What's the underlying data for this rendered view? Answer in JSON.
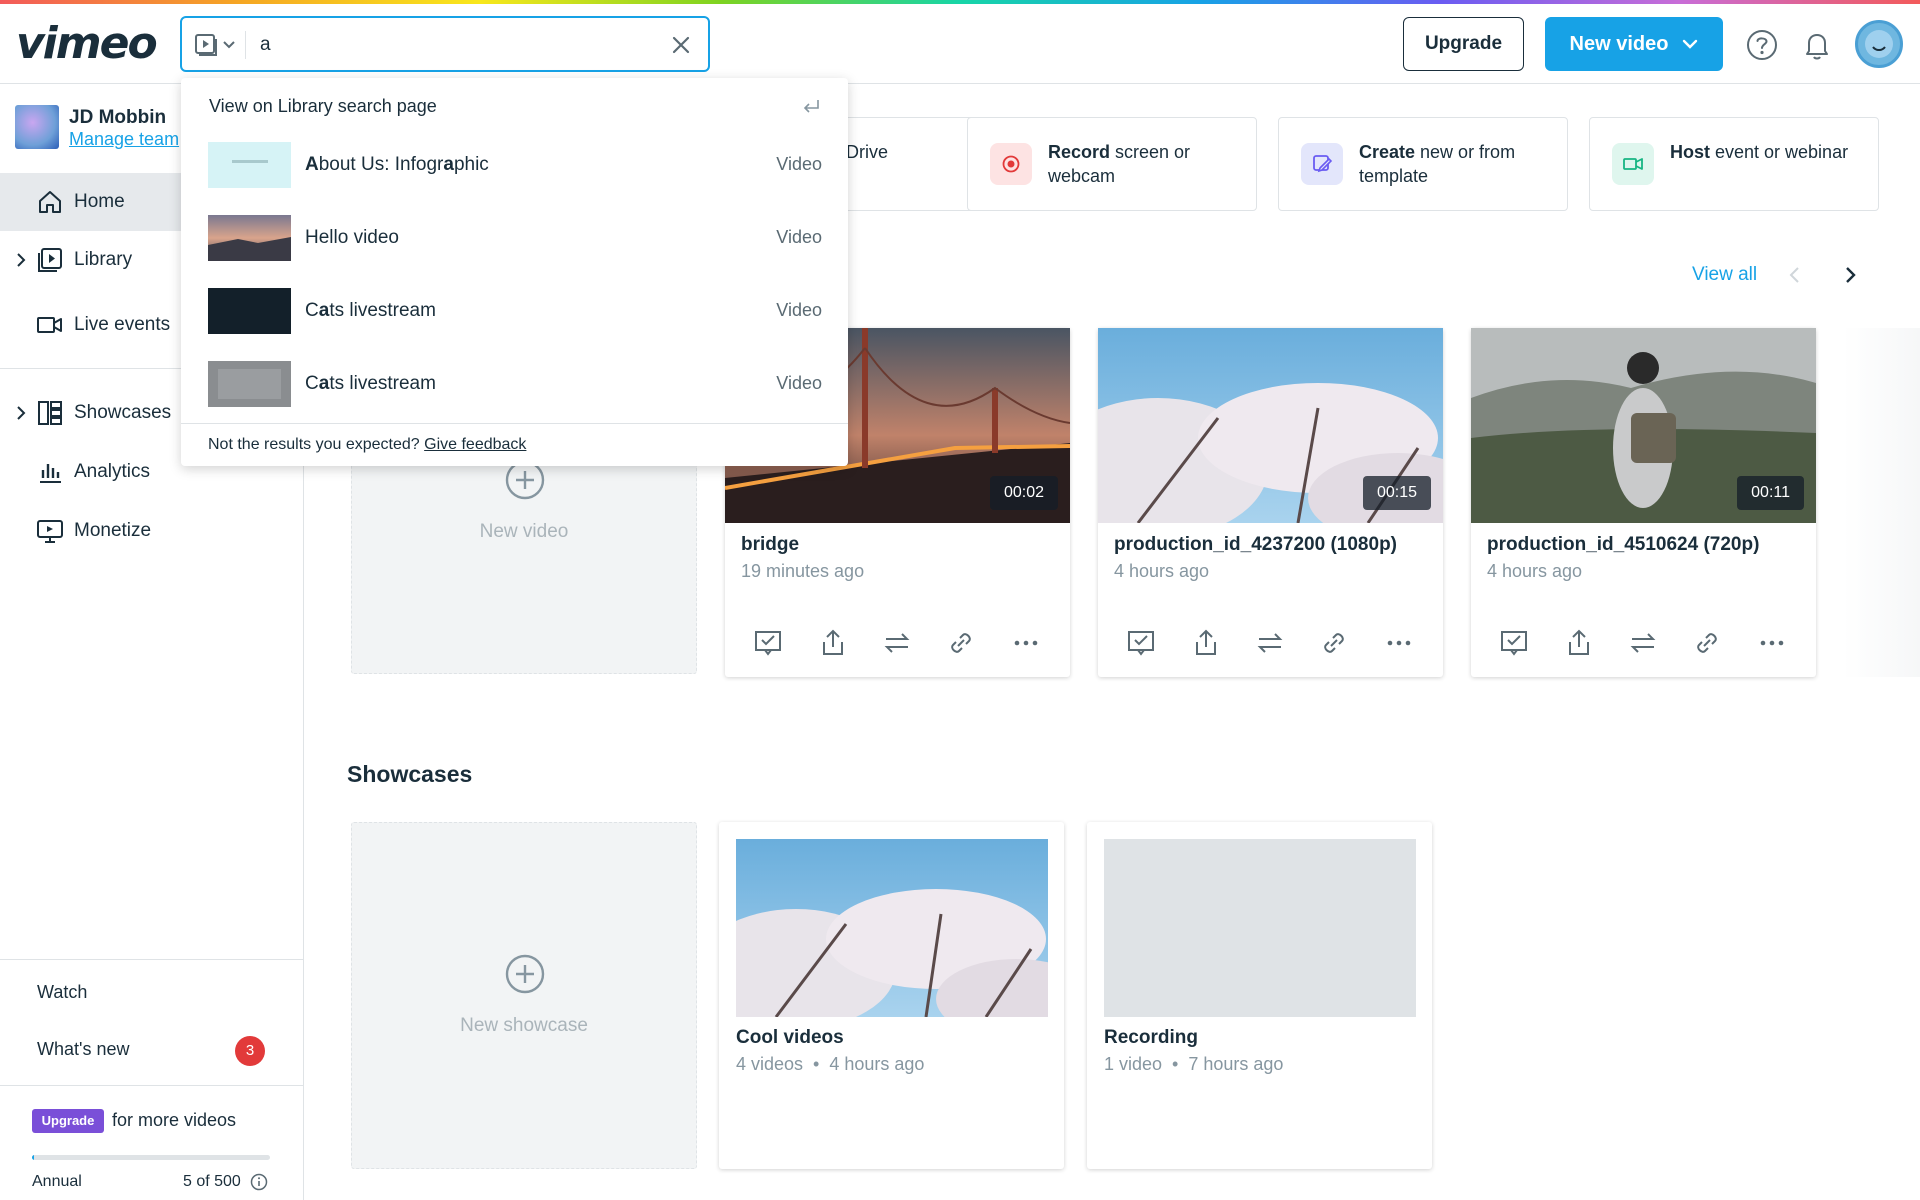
{
  "brand": {
    "logo": "vimeo"
  },
  "search": {
    "value": "a",
    "scope_icon": "video-library-icon"
  },
  "header": {
    "upgrade_label": "Upgrade",
    "new_video_label": "New video"
  },
  "team": {
    "name": "JD Mobbin",
    "manage_link": "Manage team"
  },
  "sidebar": {
    "items": [
      {
        "label": "Home",
        "icon": "home-icon"
      },
      {
        "label": "Library",
        "icon": "library-icon"
      },
      {
        "label": "Live events",
        "icon": "camera-icon"
      },
      {
        "label": "Showcases",
        "icon": "showcase-icon"
      },
      {
        "label": "Analytics",
        "icon": "analytics-icon"
      },
      {
        "label": "Monetize",
        "icon": "monetize-icon"
      }
    ],
    "watch": "Watch",
    "whats_new": "What's new",
    "whats_new_count": "3",
    "upgrade_badge": "Upgrade",
    "upgrade_text": "for more videos",
    "plan": "Annual",
    "usage": "5 of 500",
    "usage_fraction": 0.01
  },
  "actions": [
    {
      "bold": "",
      "text": "Drive"
    },
    {
      "bold": "Record",
      "text": " screen or webcam",
      "color": "#fde3e3",
      "accent": "#e23a3a"
    },
    {
      "bold": "Create",
      "text": " new or from template",
      "color": "#e3e6fb",
      "accent": "#6a5cf2"
    },
    {
      "bold": "Host",
      "text": " event or webinar",
      "color": "#dff6ee",
      "accent": "#17b583"
    }
  ],
  "recent": {
    "view_all": "View all",
    "new_video": "New video",
    "videos": [
      {
        "title": "bridge",
        "time": "19 minutes ago",
        "duration": "00:02"
      },
      {
        "title": "production_id_4237200 (1080p)",
        "time": "4 hours ago",
        "duration": "00:15"
      },
      {
        "title": "production_id_4510624 (720p)",
        "time": "4 hours ago",
        "duration": "00:11"
      }
    ]
  },
  "showcases": {
    "title": "Showcases",
    "new_showcase": "New showcase",
    "items": [
      {
        "title": "Cool videos",
        "videos": "4 videos",
        "time": "4 hours ago"
      },
      {
        "title": "Recording",
        "videos": "1 video",
        "time": "7 hours ago"
      }
    ]
  },
  "dropdown": {
    "header": "View on Library search page",
    "results": [
      {
        "prefix": "",
        "bold": "A",
        "rest": "bout Us: Infogr",
        "bold2": "a",
        "rest2": "phic",
        "type": "Video"
      },
      {
        "prefix": "Hello video",
        "bold": "",
        "rest": "",
        "bold2": "",
        "rest2": "",
        "type": "Video"
      },
      {
        "prefix": "C",
        "bold": "a",
        "rest": "ts livestream",
        "bold2": "",
        "rest2": "",
        "type": "Video"
      },
      {
        "prefix": "C",
        "bold": "a",
        "rest": "ts livestream",
        "bold2": "",
        "rest2": "",
        "type": "Video"
      }
    ],
    "footer_text": "Not the results you expected?",
    "footer_link": "Give feedback"
  }
}
